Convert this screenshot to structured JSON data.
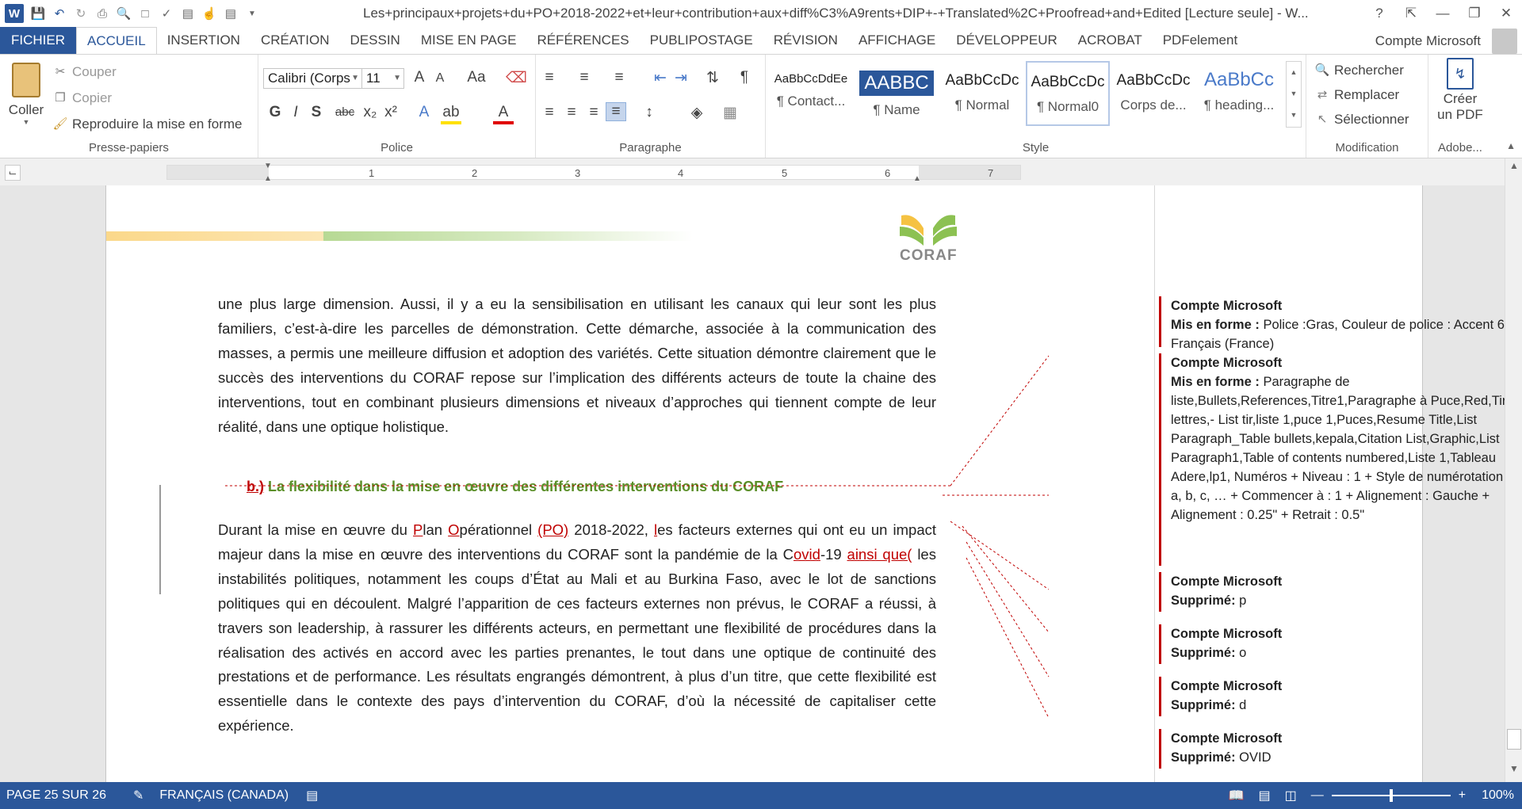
{
  "window": {
    "title": "Les+principaux+projets+du+PO+2018-2022+et+leur+contribution+aux+diff%C3%A9rents+DIP+-+Translated%2C+Proofread+and+Edited [Lecture seule] - W...",
    "help": "?"
  },
  "tabs": [
    {
      "label": "FICHIER"
    },
    {
      "label": "ACCUEIL"
    },
    {
      "label": "INSERTION"
    },
    {
      "label": "CRÉATION"
    },
    {
      "label": "DESSIN"
    },
    {
      "label": "MISE EN PAGE"
    },
    {
      "label": "RÉFÉRENCES"
    },
    {
      "label": "PUBLIPOSTAGE"
    },
    {
      "label": "RÉVISION"
    },
    {
      "label": "AFFICHAGE"
    },
    {
      "label": "DÉVELOPPEUR"
    },
    {
      "label": "ACROBAT"
    },
    {
      "label": "PDFelement"
    }
  ],
  "account": "Compte Microsoft",
  "clipboard": {
    "paste": "Coller",
    "cut": "Couper",
    "copy": "Copier",
    "format_painter": "Reproduire la mise en forme",
    "label": "Presse-papiers"
  },
  "font": {
    "name": "Calibri (Corps",
    "size": "11",
    "bold": "G",
    "italic": "I",
    "underline": "S",
    "strike": "abc",
    "case": "Aa",
    "grow": "A",
    "shrink": "A",
    "label": "Police"
  },
  "paragraph": {
    "label": "Paragraphe"
  },
  "styles": {
    "label": "Style",
    "items": [
      {
        "preview": "AaBbCcDdEe",
        "name": "¶ Contact..."
      },
      {
        "preview": "AABBC",
        "name": "¶ Name"
      },
      {
        "preview": "AaBbCcDc",
        "name": "¶ Normal"
      },
      {
        "preview": "AaBbCcDc",
        "name": "¶ Normal0"
      },
      {
        "preview": "AaBbCcDc",
        "name": "Corps de..."
      },
      {
        "preview": "AaBbCc",
        "name": "¶ heading..."
      }
    ]
  },
  "editing": {
    "find": "Rechercher",
    "replace": "Remplacer",
    "select": "Sélectionner",
    "label": "Modification"
  },
  "adobe": {
    "create_pdf_1": "Créer",
    "create_pdf_2": "un PDF",
    "label": "Adobe..."
  },
  "ruler": {
    "numbers": [
      "1",
      "2",
      "3",
      "4",
      "5",
      "6",
      "7"
    ]
  },
  "logo": {
    "text": "CORAF"
  },
  "document": {
    "para1": "une plus large dimension. Aussi, il y a eu la sensibilisation en utilisant les canaux qui leur sont les plus familiers, c’est-à-dire les parcelles de démonstration. Cette démarche, associée à la communication des masses, a permis une meilleure diffusion et adoption des variétés. Cette situation démontre clairement que le succès des interventions du CORAF repose sur l’implication des différents acteurs de toute la chaine des interventions, tout en combinant plusieurs dimensions et niveaux d’approches qui tiennent compte de leur réalité, dans une optique holistique.",
    "heading_marker": "b.)",
    "heading_text": "La flexibilité dans la mise en œuvre des différentes interventions du CORAF",
    "para2_a": "Durant la mise en œuvre du ",
    "para2_P": "P",
    "para2_b": "lan ",
    "para2_O": "O",
    "para2_c": "pérationnel ",
    "para2_PO": "(PO)",
    "para2_d": " 2018-2022, ",
    "para2_l": "l",
    "para2_e": "es facteurs externes qui ont eu un impact majeur dans la mise en œuvre des interventions du CORAF sont la pandémie de la C",
    "para2_ovid": "ovid",
    "para2_f": "-19 ",
    "para2_ainsi": "ainsi que(",
    "para2_g": " les instabilités politiques, notamment les coups d’État au Mali et au Burkina Faso, avec le lot de sanctions politiques qui en découlent. Malgré l’apparition de ces facteurs externes non prévus, le CORAF a réussi, à travers son leadership, à rassurer les différents acteurs, en permettant une flexibilité de procédures dans la réalisation des activés en accord avec les parties prenantes, le tout dans une optique de continuité des prestations et de performance. Les résultats engrangés démontrent, à plus d’un titre, que cette flexibilité est essentielle dans le contexte des pays d’intervention du CORAF, d’où la nécessité de capitaliser cette expérience."
  },
  "comments": [
    {
      "author": "Compte Microsoft",
      "label": "Mis en forme :",
      "text": " Police :Gras, Couleur de police : Accent 6, Français (France)"
    },
    {
      "author": "Compte Microsoft",
      "label": "Mis en forme :",
      "text": " Paragraphe de liste,Bullets,References,Titre1,Paragraphe à Puce,Red,Tiret lettres,- List tir,liste 1,puce 1,Puces,Resume Title,List Paragraph_Table bullets,kepala,Citation List,Graphic,List Paragraph1,Table of contents numbered,Liste 1,Tableau Adere,lp1, Numéros + Niveau : 1 + Style de numérotation : a, b, c, … + Commencer à : 1 + Alignement : Gauche + Alignement :  0.25\" + Retrait :  0.5\""
    },
    {
      "author": "Compte Microsoft",
      "label": "Supprimé:",
      "text": " p"
    },
    {
      "author": "Compte Microsoft",
      "label": "Supprimé:",
      "text": " o"
    },
    {
      "author": "Compte Microsoft",
      "label": "Supprimé:",
      "text": " d"
    },
    {
      "author": "Compte Microsoft",
      "label": "Supprimé:",
      "text": " OVID"
    }
  ],
  "status": {
    "page": "PAGE 25 SUR 26",
    "language": "FRANÇAIS (CANADA)",
    "zoom": "100%",
    "zoom_level": 1.0
  },
  "colors": {
    "accent": "#2b579a",
    "track_change": "#c00000",
    "heading_green": "#5b8f29"
  }
}
